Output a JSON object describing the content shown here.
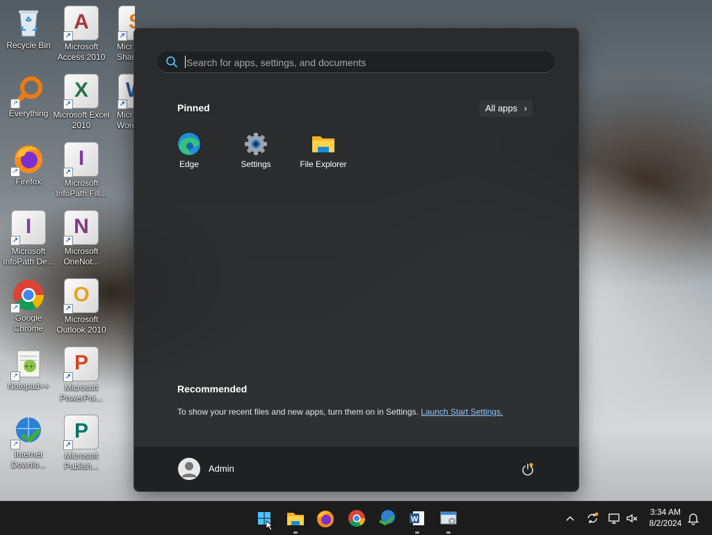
{
  "desktop": {
    "icons": [
      {
        "label": "Recycle Bin",
        "icon": "recycle-bin-icon"
      },
      {
        "label": "Microsoft Access 2010",
        "icon": "access-icon"
      },
      {
        "label": "Micr Share",
        "icon": "sharepoint-icon"
      },
      {
        "label": "Everything",
        "icon": "everything-search-icon"
      },
      {
        "label": "Microsoft Excel 2010",
        "icon": "excel-icon"
      },
      {
        "label": "Micr Word",
        "icon": "word-icon"
      },
      {
        "label": "Firefox",
        "icon": "firefox-icon"
      },
      {
        "label": "Microsoft InfoPath Fill...",
        "icon": "infopath-filler-icon"
      },
      {
        "label": "Microsoft InfoPath De...",
        "icon": "infopath-designer-icon"
      },
      {
        "label": "Microsoft OneNot...",
        "icon": "onenote-icon"
      },
      {
        "label": "Google Chrome",
        "icon": "chrome-icon"
      },
      {
        "label": "Microsoft Outlook 2010",
        "icon": "outlook-icon"
      },
      {
        "label": "Notepad++",
        "icon": "notepadpp-icon"
      },
      {
        "label": "Microsoft PowerPoi...",
        "icon": "powerpoint-icon"
      },
      {
        "label": "Internet Downlo...",
        "icon": "internet-download-manager-icon"
      },
      {
        "label": "Microsoft Publish...",
        "icon": "publisher-icon"
      }
    ]
  },
  "start_menu": {
    "search_placeholder": "Search for apps, settings, and documents",
    "pinned_title": "Pinned",
    "all_apps_label": "All apps",
    "all_apps_chevron": "›",
    "pinned_apps": [
      {
        "label": "Edge",
        "icon": "edge-icon"
      },
      {
        "label": "Settings",
        "icon": "settings-gear-icon"
      },
      {
        "label": "File Explorer",
        "icon": "folder-icon"
      }
    ],
    "recommended_title": "Recommended",
    "recommended_text": "To show your recent files and new apps, turn them on in Settings.",
    "recommended_link": "Launch Start Settings.",
    "user_name": "Admin"
  },
  "taskbar": {
    "apps": [
      "start-icon",
      "file-explorer-icon",
      "firefox-icon",
      "chrome-icon",
      "internet-download-manager-icon",
      "word-icon",
      "control-panel-icon"
    ],
    "tray_icons": [
      "chevron-up-icon",
      "sync-icon",
      "network-icon",
      "volume-muted-icon"
    ],
    "time": "3:34 AM",
    "date": "8/2/2024",
    "notification_icon": "bell-icon"
  },
  "colors": {
    "accent": "#0078d4",
    "link": "#8fc8ff",
    "start_bg": "#28292b",
    "taskbar_bg": "#1c1c1c"
  }
}
